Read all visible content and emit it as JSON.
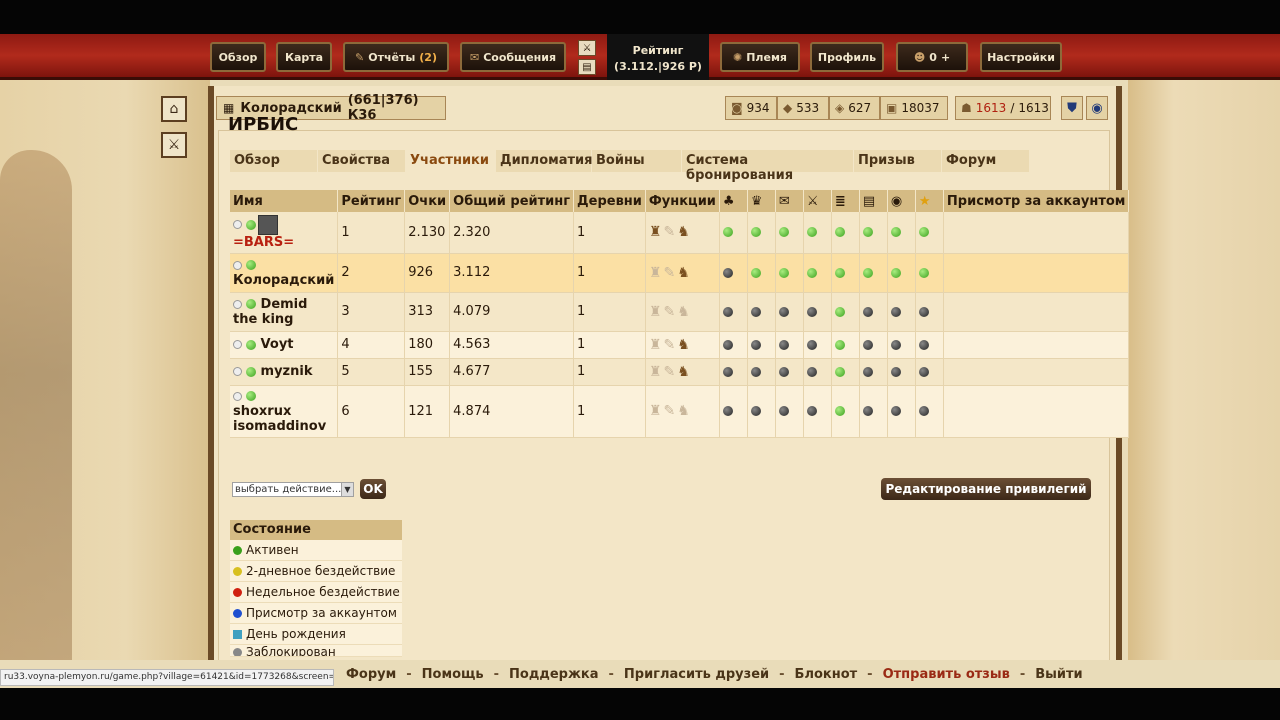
{
  "nav": {
    "overview": "Обзор",
    "map": "Карта",
    "reports": "Отчёты",
    "reports_count": "(2)",
    "messages": "Сообщения",
    "rank_title": "Рейтинг",
    "rank_value": "(3.112.|926 Р)",
    "tribe": "Племя",
    "profile": "Профиль",
    "premium_count": "0",
    "premium_plus": "+",
    "settings": "Настройки"
  },
  "village": {
    "name": "Колорадский",
    "coords": "(661|376) К36"
  },
  "resources": {
    "wood": "934",
    "clay": "533",
    "iron": "627",
    "storage": "18037",
    "pop_current": "1613",
    "pop_sep": "/",
    "pop_max": "1613"
  },
  "page": {
    "title": "ИРБИС"
  },
  "tabs": [
    "Обзор",
    "Свойства",
    "Участники",
    "Дипломатия",
    "Войны",
    "Система бронирования",
    "Призыв",
    "Форум"
  ],
  "table": {
    "headers": {
      "name": "Имя",
      "rank": "Рейтинг",
      "points": "Очки",
      "global_rank": "Общий рейтинг",
      "villages": "Деревни",
      "functions": "Функции",
      "account_sitting": "Присмотр за аккаунтом"
    },
    "rows": [
      {
        "name": "=BARS=",
        "rank": "1",
        "points": "2.130",
        "global_rank": "2.320",
        "villages": "1"
      },
      {
        "name": "Колорадский",
        "rank": "2",
        "points": "926",
        "global_rank": "3.112",
        "villages": "1"
      },
      {
        "name": "Demid the king",
        "rank": "3",
        "points": "313",
        "global_rank": "4.079",
        "villages": "1"
      },
      {
        "name": "Voyt",
        "rank": "4",
        "points": "180",
        "global_rank": "4.563",
        "villages": "1"
      },
      {
        "name": "myznik",
        "rank": "5",
        "points": "155",
        "global_rank": "4.677",
        "villages": "1"
      },
      {
        "name": "shoxrux isomaddinov",
        "rank": "6",
        "points": "121",
        "global_rank": "4.874",
        "villages": "1"
      }
    ]
  },
  "actions": {
    "select_placeholder": "выбрать действие...",
    "ok": "OK",
    "edit_privileges": "Редактирование привилегий"
  },
  "legend": {
    "title": "Состояние",
    "items": [
      "Активен",
      "2-дневное бездействие",
      "Недельное бездействие",
      "Присмотр за аккаунтом",
      "День рождения",
      "Заблокирован"
    ],
    "colors": [
      "#3aa01c",
      "#d8c020",
      "#d02010",
      "#2050d0",
      "#40a0c0",
      "#888888"
    ]
  },
  "footer": {
    "links": [
      "Форум",
      "Помощь",
      "Поддержка",
      "Пригласить друзей",
      "Блокнот",
      "Отправить отзыв",
      "Выйти"
    ]
  },
  "status_url": "ru33.voyna-plemyon.ru/game.php?village=61421&id=1773268&screen=info_player"
}
